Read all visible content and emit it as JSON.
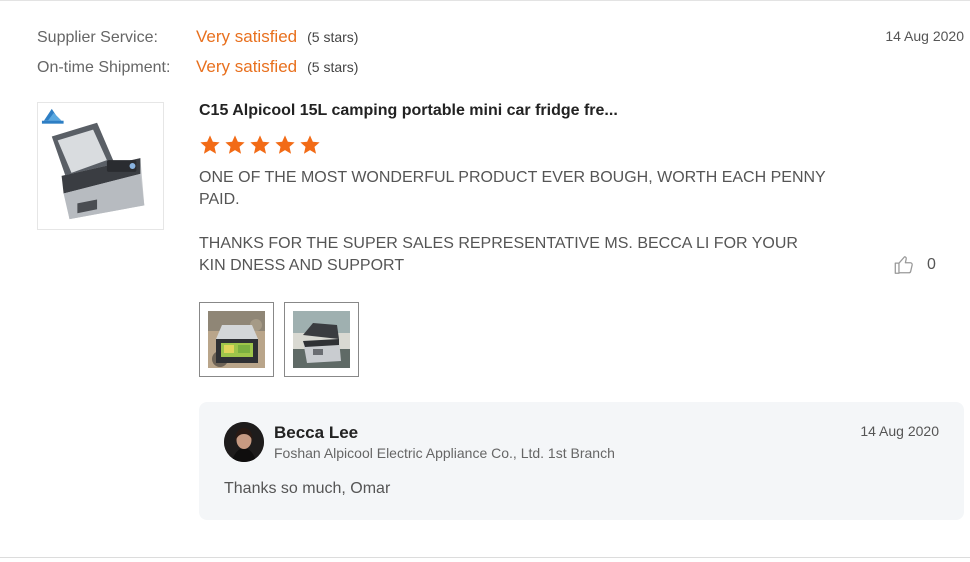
{
  "ratings": [
    {
      "label": "Supplier Service:",
      "value": "Very satisfied",
      "note": "(5 stars)"
    },
    {
      "label": "On-time Shipment:",
      "value": "Very satisfied",
      "note": "(5 stars)"
    }
  ],
  "review": {
    "date": "14 Aug 2020",
    "product_title": "C15 Alpicool 15L camping portable mini car fridge fre...",
    "star_rating": 5,
    "star_color": "#f26b16",
    "paragraphs": [
      "ONE OF THE MOST WONDERFUL PRODUCT EVER BOUGH, WORTH EACH PENNY PAID.",
      "THANKS FOR THE SUPER SALES REPRESENTATIVE MS. BECCA LI FOR YOUR KIN DNESS AND SUPPORT"
    ],
    "like_count": "0",
    "like_icon": "thumbs-up-icon",
    "photos": [
      "review-photo-1",
      "review-photo-2"
    ]
  },
  "reply": {
    "name": "Becca Lee",
    "company": "Foshan Alpicool Electric Appliance Co., Ltd. 1st Branch",
    "date": "14 Aug 2020",
    "message": "Thanks so much, Omar"
  },
  "colors": {
    "accent": "#e8701e",
    "reply_bg": "#f4f6f8"
  }
}
